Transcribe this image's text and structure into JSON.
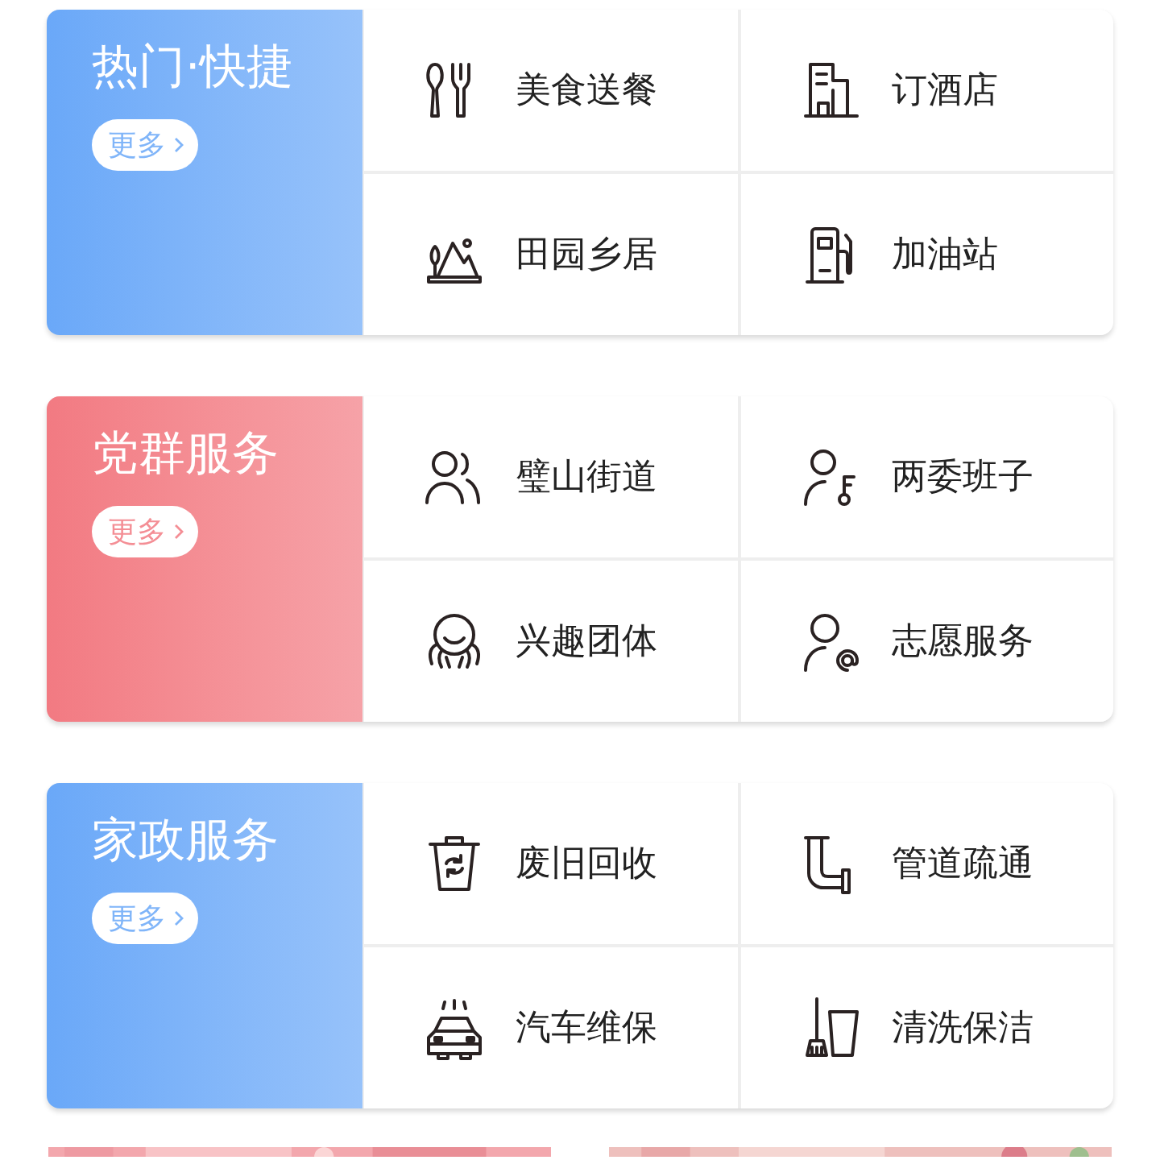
{
  "sections": [
    {
      "title": "热门·快捷",
      "color": "#6aa8f8",
      "more": "更多",
      "items": [
        "美食送餐",
        "订酒店",
        "田园乡居",
        "加油站"
      ]
    },
    {
      "title": "党群服务",
      "color": "#f27a82",
      "more": "更多",
      "items": [
        "璧山街道",
        "两委班子",
        "兴趣团体",
        "志愿服务"
      ]
    },
    {
      "title": "家政服务",
      "color": "#6aa8f8",
      "more": "更多",
      "items": [
        "废旧回收",
        "管道疏通",
        "汽车维保",
        "清洗保洁"
      ]
    }
  ]
}
